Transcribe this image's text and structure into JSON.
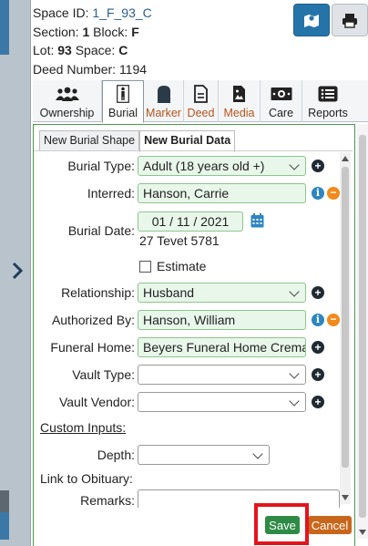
{
  "header": {
    "space_id_label": "Space ID:",
    "space_id_value": "1_F_93_C",
    "section_label": "Section:",
    "section_value": "1",
    "block_label": "Block:",
    "block_value": "F",
    "lot_label": "Lot:",
    "lot_value": "93",
    "space_label": "Space:",
    "space_value": "C",
    "deed_label": "Deed Number:",
    "deed_value": "1194"
  },
  "tabs": [
    {
      "label": "Ownership",
      "icon": "people-icon"
    },
    {
      "label": "Burial",
      "icon": "person-standing-icon",
      "active": true
    },
    {
      "label": "Marker",
      "icon": "headstone-icon"
    },
    {
      "label": "Deed",
      "icon": "document-icon"
    },
    {
      "label": "Media",
      "icon": "image-file-icon"
    },
    {
      "label": "Care",
      "icon": "money-icon"
    },
    {
      "label": "Reports",
      "icon": "list-icon"
    }
  ],
  "subtabs": {
    "shape": "New Burial Shape",
    "data": "New Burial Data"
  },
  "form": {
    "burial_type_label": "Burial Type:",
    "burial_type_value": "Adult (18 years old +)",
    "interred_label": "Interred:",
    "interred_value": "Hanson, Carrie",
    "burial_date_label": "Burial Date:",
    "burial_date_value": "01 / 11 / 2021",
    "hebrew_date": "27 Tevet 5781",
    "estimate_label": "Estimate",
    "relationship_label": "Relationship:",
    "relationship_value": "Husband",
    "authorized_by_label": "Authorized By:",
    "authorized_by_value": "Hanson, William",
    "funeral_home_label": "Funeral Home:",
    "funeral_home_value": "Beyers Funeral Home Crema",
    "vault_type_label": "Vault Type:",
    "vault_type_value": "",
    "vault_vendor_label": "Vault Vendor:",
    "vault_vendor_value": "",
    "custom_inputs_label": "Custom Inputs:",
    "depth_label": "Depth:",
    "depth_value": "",
    "obituary_label": "Link to Obituary:",
    "remarks_label": "Remarks:",
    "remarks_value": ""
  },
  "actions": {
    "save": "Save",
    "cancel": "Cancel"
  },
  "colors": {
    "accent_blue": "#2574a9",
    "save_green": "#2e8b45",
    "cancel_orange": "#c8661c",
    "highlight_red": "#e4141b"
  }
}
